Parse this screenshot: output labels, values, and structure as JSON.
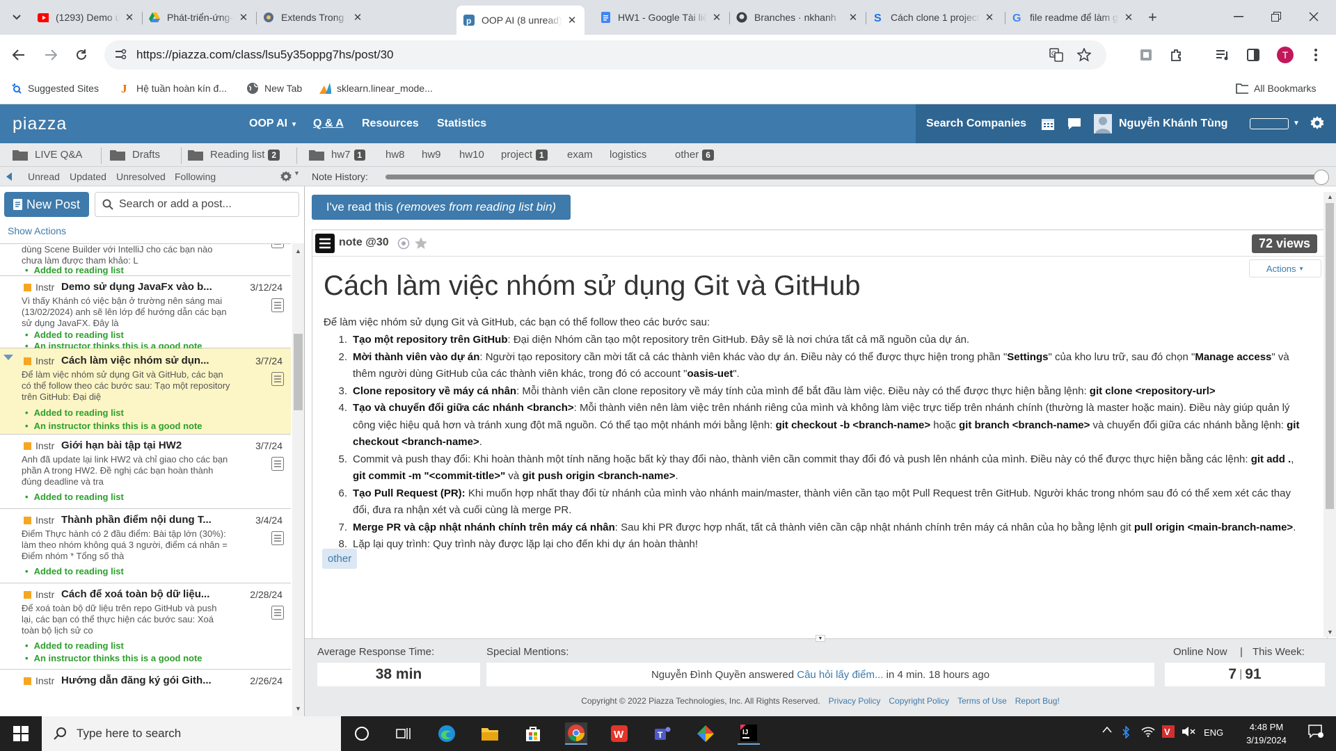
{
  "browser": {
    "tabs": [
      {
        "title": "(1293) Demo ứng dụng",
        "icon": "youtube-icon"
      },
      {
        "title": "Phát-triển-ứng-dụng",
        "icon": "google-drive-icon"
      },
      {
        "title": "Extends Trong Java",
        "icon": "site-icon"
      },
      {
        "title": "OOP AI (8 unread)",
        "icon": "piazza-icon",
        "active": true
      },
      {
        "title": "HW1 - Google Tài liệu",
        "icon": "google-docs-icon"
      },
      {
        "title": "Branches · nkhanh",
        "icon": "github-icon"
      },
      {
        "title": "Cách clone 1 project",
        "icon": "site-s-icon"
      },
      {
        "title": "file readme để làm gì",
        "icon": "google-icon"
      }
    ],
    "url": "https://piazza.com/class/lsu5y35oppg7hs/post/30",
    "profile_initial": "T",
    "bookmarks": [
      {
        "label": "Suggested Sites"
      },
      {
        "label": "Hệ tuần hoàn kín đ..."
      },
      {
        "label": "New Tab"
      },
      {
        "label": "sklearn.linear_mode..."
      }
    ],
    "all_bookmarks": "All Bookmarks"
  },
  "header": {
    "logo": "piazza",
    "course": "OOP AI",
    "nav": [
      "Q & A",
      "Resources",
      "Statistics"
    ],
    "search_companies": "Search Companies",
    "user": "Nguyễn Khánh Tùng"
  },
  "folders": {
    "left": [
      {
        "label": "LIVE Q&A",
        "badge": ""
      },
      {
        "label": "Drafts",
        "badge": ""
      },
      {
        "label": "Reading list",
        "badge": "2"
      }
    ],
    "right": [
      {
        "label": "hw7",
        "badge": "1"
      },
      {
        "label": "hw8",
        "badge": ""
      },
      {
        "label": "hw9",
        "badge": ""
      },
      {
        "label": "hw10",
        "badge": ""
      },
      {
        "label": "project",
        "badge": "1"
      },
      {
        "label": "exam",
        "badge": ""
      },
      {
        "label": "logistics",
        "badge": ""
      },
      {
        "label": "other",
        "badge": "6"
      }
    ]
  },
  "filters": [
    "Unread",
    "Updated",
    "Unresolved",
    "Following"
  ],
  "note_history_label": "Note History:",
  "sidebar": {
    "new_post": "New Post",
    "search_placeholder": "Search or add a post...",
    "show_actions": "Show Actions",
    "partial_post": {
      "body": "dùng Scene Builder với IntelliJ cho các bạn nào chưa làm được tham khảo: L",
      "reading": "Added to reading list"
    },
    "posts": [
      {
        "tag": "Instr",
        "title": "Demo sử dụng JavaFx vào b...",
        "date": "3/12/24",
        "body": "Vì thấy Khánh có việc bận ở trường nên sáng mai (13/02/2024) anh sẽ lên lớp để hướng dẫn các bạn sử dụng JavaFX. Đây là",
        "reading": "Added to reading list",
        "good": "An instructor thinks this is a good note"
      },
      {
        "tag": "Instr",
        "title": "Cách làm việc nhóm sử dụn...",
        "date": "3/7/24",
        "body": "Để làm việc nhóm sử dụng Git và GitHub, các bạn có thể follow theo các bước sau: Tạo một repository trên GitHub: Đại diệ",
        "reading": "Added to reading list",
        "good": "An instructor thinks this is a good note",
        "selected": true
      },
      {
        "tag": "Instr",
        "title": "Giới hạn bài tập tại HW2",
        "date": "3/7/24",
        "body": "Anh đã update lại link HW2 và chỉ giao cho các bạn phần A trong HW2. Đề nghị các bạn hoàn thành đúng deadline và tra",
        "reading": "Added to reading list",
        "good": ""
      },
      {
        "tag": "Instr",
        "title": "Thành phần điểm nội dung T...",
        "date": "3/4/24",
        "body": "Điểm Thực hành có 2 đầu điểm: Bài tập lớn (30%): làm theo nhóm không quá 3 người, điểm cá nhân = Điểm nhóm * Tổng số thà",
        "reading": "Added to reading list",
        "good": ""
      },
      {
        "tag": "Instr",
        "title": "Cách để xoá toàn bộ dữ liệu...",
        "date": "2/28/24",
        "body": "Để xoá toàn bộ dữ liệu trên repo GitHub và push lại, các bạn có thể thực hiện các bước sau:  Xoá toàn bộ lịch sử co",
        "reading": "Added to reading list",
        "good": "An instructor thinks this is a good note"
      },
      {
        "tag": "Instr",
        "title": "Hướng dẫn đăng ký gói Gith...",
        "date": "2/26/24",
        "body": "",
        "reading": "",
        "good": ""
      }
    ]
  },
  "note": {
    "read_button_main": "I've read this ",
    "read_button_em": "(removes from reading list bin)",
    "label": "note @30",
    "views": "72 views",
    "actions": "Actions",
    "title": "Cách làm việc nhóm sử dụng Git và GitHub",
    "intro": "Để làm việc nhóm sử dụng Git và GitHub, các bạn có thể follow theo các bước sau:",
    "tag": "other"
  },
  "stats": {
    "avg_label": "Average Response Time:",
    "avg_value": "38 min",
    "mentions_label": "Special Mentions:",
    "mention_user": "Nguyễn Đình Quyền answered ",
    "mention_link": "Câu hỏi lấy điểm...",
    "mention_tail": " in 4 min. 18 hours ago",
    "online_label": "Online Now",
    "sep": "|",
    "week_label": "This Week:",
    "online_value": "7",
    "week_value": "91"
  },
  "footer": {
    "copyright": "Copyright © 2022 Piazza Technologies, Inc. All Rights Reserved.",
    "links": [
      "Privacy Policy",
      "Copyright Policy",
      "Terms of Use",
      "Report Bug!"
    ]
  },
  "taskbar": {
    "search_placeholder": "Type here to search",
    "lang": "ENG",
    "time": "4:48 PM",
    "date": "3/19/2024"
  },
  "colors": {
    "piazza_blue": "#3e7aab",
    "header_dark": "#2f6591",
    "reading_green": "#2d9f2d",
    "selected_post": "#fcf5c5"
  }
}
